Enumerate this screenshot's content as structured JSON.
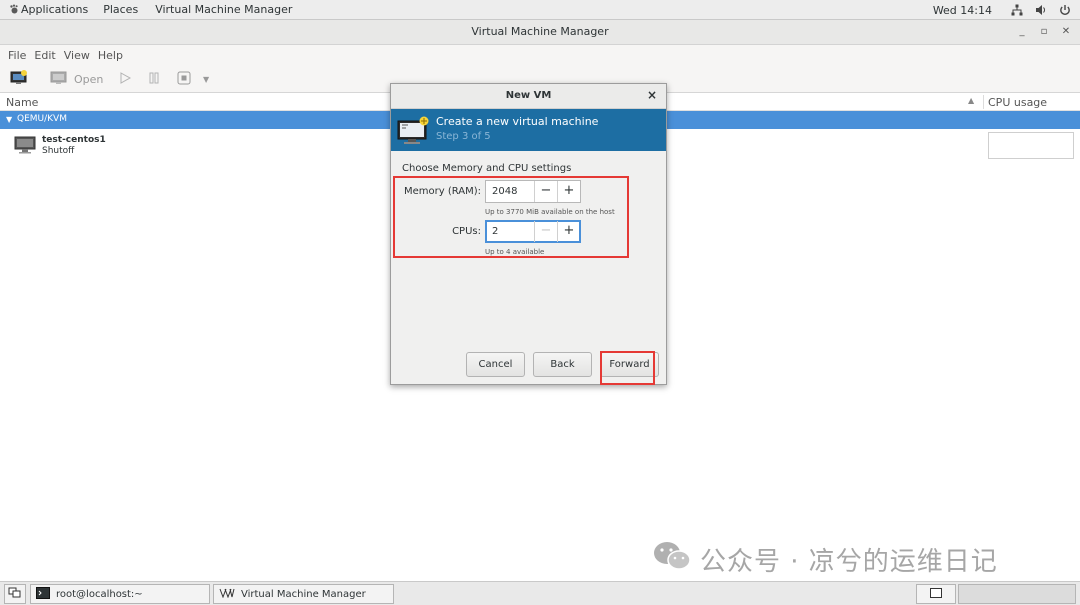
{
  "topbar": {
    "applications": "Applications",
    "places": "Places",
    "app_name": "Virtual Machine Manager",
    "clock": "Wed 14:14"
  },
  "window": {
    "title": "Virtual Machine Manager",
    "menu": [
      "File",
      "Edit",
      "View",
      "Help"
    ],
    "toolbar": {
      "open_label": "Open"
    },
    "columns": {
      "name": "Name",
      "cpu": "CPU usage"
    },
    "connection": "QEMU/KVM",
    "vms": [
      {
        "name": "test-centos1",
        "status": "Shutoff"
      }
    ]
  },
  "dialog": {
    "title": "New VM",
    "banner_title": "Create a new virtual machine",
    "step": "Step 3 of 5",
    "section": "Choose Memory and CPU settings",
    "memory_label": "Memory (RAM):",
    "memory_value": "2048",
    "memory_hint": "Up to 3770 MiB available on the host",
    "cpus_label": "CPUs:",
    "cpus_value": "2",
    "cpus_hint": "Up to 4 available",
    "buttons": {
      "cancel": "Cancel",
      "back": "Back",
      "forward": "Forward"
    }
  },
  "taskbar": {
    "items": [
      "root@localhost:~",
      "Virtual Machine Manager"
    ]
  },
  "watermark": "公众号 · 凉兮的运维日记",
  "colors": {
    "selection": "#4a90d9",
    "banner": "#1d6ea3",
    "highlight": "#e53935"
  }
}
